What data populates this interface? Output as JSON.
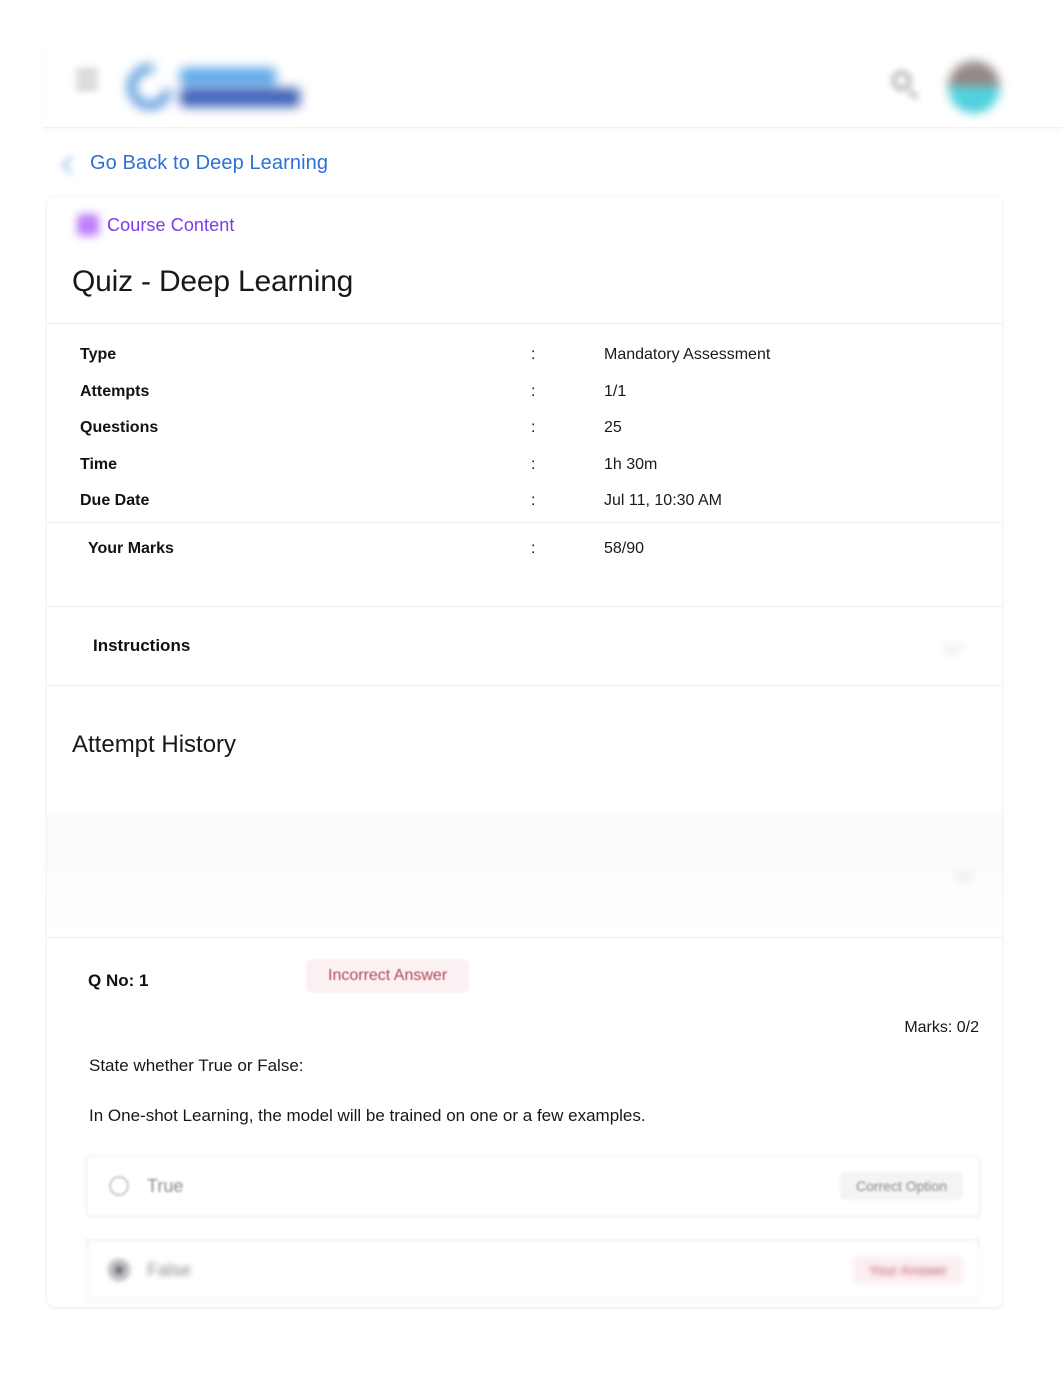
{
  "header": {
    "menu_icon": "hamburger-icon",
    "logo_alt": "Great Learning",
    "search_icon": "search-icon",
    "avatar_icon": "user-avatar"
  },
  "nav": {
    "back_icon": "back-arrow-icon",
    "back_label": "Go Back to Deep Learning"
  },
  "breadcrumb": {
    "icon": "book-icon",
    "label": "Course Content"
  },
  "page_title": "Quiz - Deep Learning",
  "details": {
    "rows": [
      {
        "key": "Type",
        "colon": ":",
        "value": "Mandatory Assessment"
      },
      {
        "key": "Attempts",
        "colon": ":",
        "value": "1/1"
      },
      {
        "key": "Questions",
        "colon": ":",
        "value": "25"
      },
      {
        "key": "Time",
        "colon": ":",
        "value": "1h 30m"
      },
      {
        "key": "Due Date",
        "colon": ":",
        "value": "Jul 11, 10:30 AM"
      }
    ],
    "marks": {
      "key": "Your Marks",
      "colon": ":",
      "value": "58/90"
    }
  },
  "instructions": {
    "label": "Instructions",
    "toggle_icon": "chevron-down-icon"
  },
  "attempt_history": {
    "title": "Attempt History",
    "expand_icon": "chevron-down-icon"
  },
  "question": {
    "number_label": "Q No: 1",
    "status": "Incorrect Answer",
    "marks": "Marks: 0/2",
    "prompt_line_1": "State whether True or False:",
    "prompt_line_2": "In One-shot Learning, the model will be trained on one or a few examples.",
    "options": [
      {
        "label": "True",
        "tag": "Correct Option",
        "selected": false
      },
      {
        "label": "False",
        "tag": "Your Answer",
        "selected": true
      }
    ]
  },
  "colors": {
    "link_blue": "#2f6fd8",
    "breadcrumb_purple": "#7c3aed",
    "incorrect_red": "#b04a5a",
    "incorrect_bg": "#fbf1f2",
    "text_primary": "#17171a",
    "card_bg": "#ffffff",
    "page_bg": "#ffffff"
  }
}
